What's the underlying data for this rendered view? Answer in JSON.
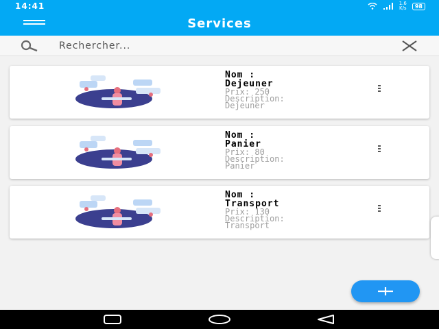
{
  "status_bar": {
    "time": "14:41",
    "speed_value": "1.6",
    "speed_unit": "K/s",
    "battery": "98",
    "icons": [
      "wifi-icon",
      "signal-icon",
      "battery-icon"
    ]
  },
  "app_bar": {
    "title": "Services",
    "menu_icon": "hamburger-menu-icon"
  },
  "search": {
    "placeholder": "Rechercher...",
    "value": "",
    "search_icon": "search-icon",
    "clear_icon": "close-icon"
  },
  "services": [
    {
      "name_label": "Nom :",
      "name": "Dejeuner",
      "price": "Prix: 250",
      "description_label": "Description:",
      "description": "Dejeuner"
    },
    {
      "name_label": "Nom :",
      "name": "Panier",
      "price": "Prix: 80",
      "description_label": "Description:",
      "description": "Panier"
    },
    {
      "name_label": "Nom :",
      "name": "Transport",
      "price": "Prix: 130",
      "description_label": "Description:",
      "description": "Transport"
    }
  ],
  "fab": {
    "icon": "plus-icon"
  },
  "nav": {
    "icons": [
      "recent-apps-icon",
      "home-icon",
      "back-icon"
    ]
  },
  "colors": {
    "primary": "#03a9f4",
    "fab": "#2196f3",
    "illustration_blob": "#3b3f8f"
  }
}
